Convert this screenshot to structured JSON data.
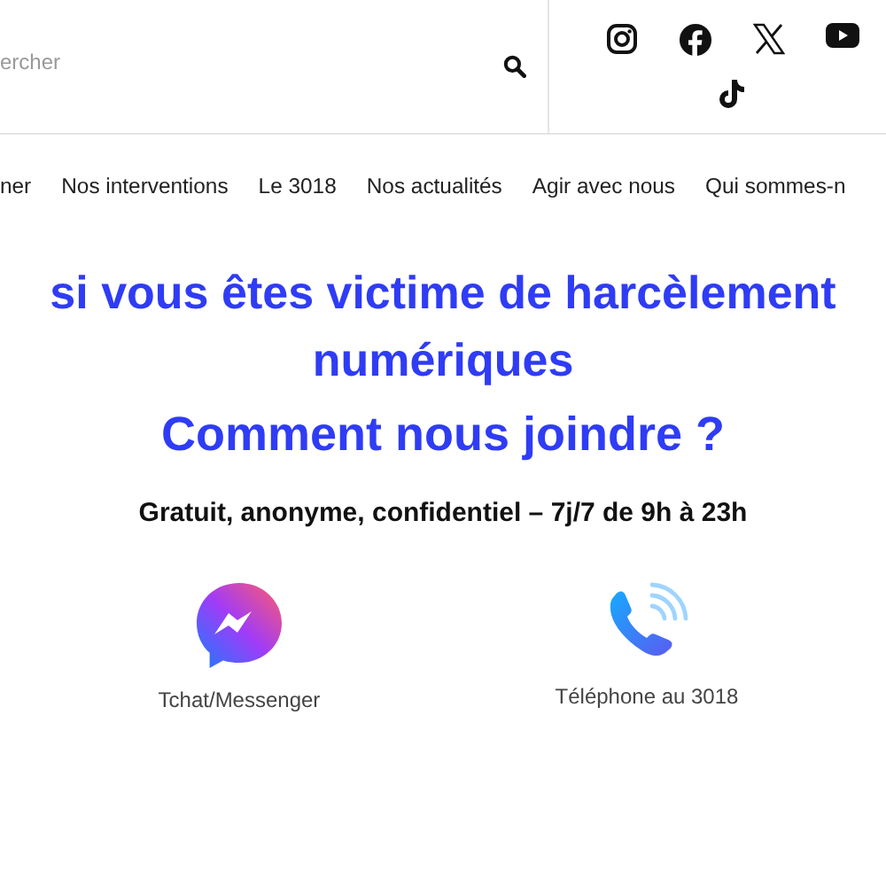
{
  "search": {
    "placeholder": "ercher"
  },
  "social": [
    {
      "kind": "instagram"
    },
    {
      "kind": "facebook"
    },
    {
      "kind": "x"
    },
    {
      "kind": "youtube"
    },
    {
      "kind": "tiktok"
    }
  ],
  "nav": [
    "ner",
    "Nos interventions",
    "Le 3018",
    "Nos actualités",
    "Agir avec nous",
    "Qui sommes-n"
  ],
  "heading": [
    "si vous êtes victime de harcèlement",
    "numériques"
  ],
  "subheading": "Comment nous joindre ?",
  "tagline": "Gratuit, anonyme, confidentiel – 7j/7 de 9h à 23h",
  "contacts": [
    {
      "kind": "messenger",
      "label": "Tchat/Messenger"
    },
    {
      "kind": "phone",
      "label": "Téléphone au 3018"
    }
  ]
}
